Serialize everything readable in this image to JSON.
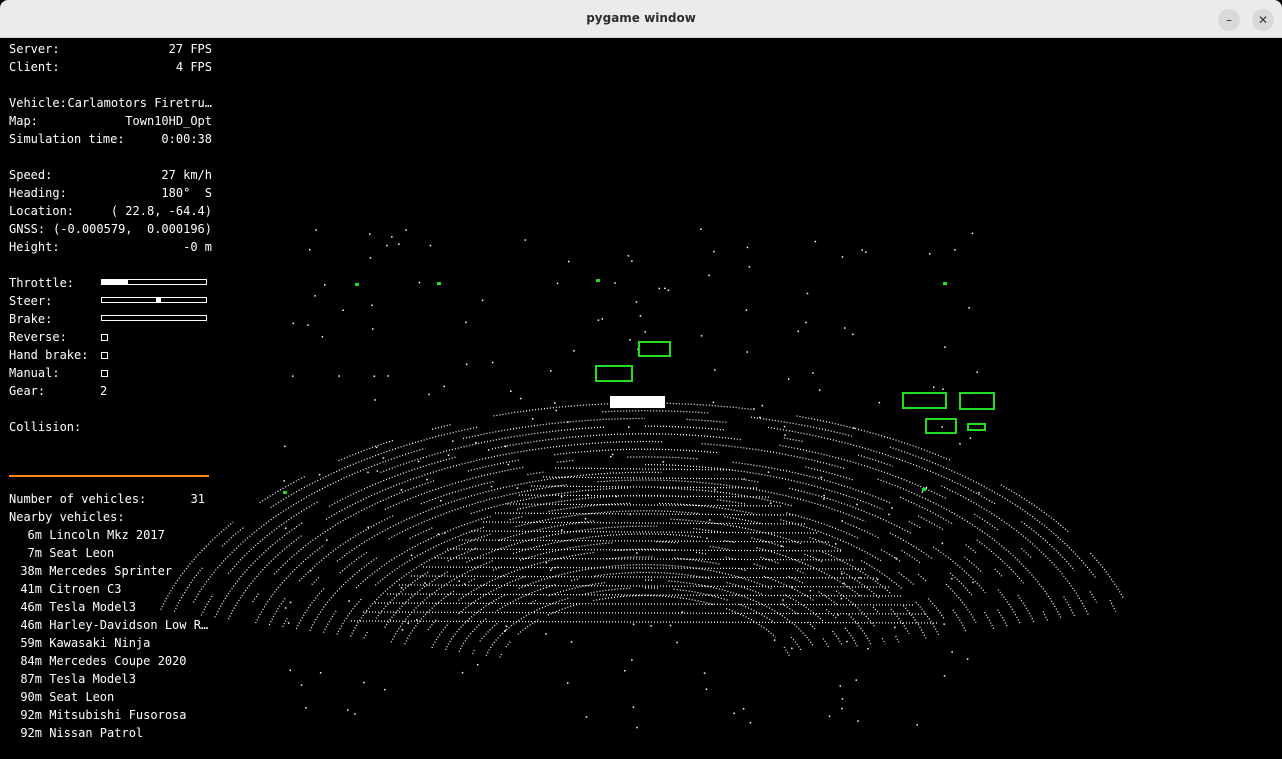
{
  "window": {
    "title": "pygame window",
    "minimize_glyph": "–",
    "close_glyph": "✕"
  },
  "hud": {
    "server_label": "Server:",
    "server_value": "27 FPS",
    "client_label": "Client:",
    "client_value": "4 FPS",
    "vehicle_label": "Vehicle:",
    "vehicle_value": "Carlamotors Firetru…",
    "map_label": "Map:",
    "map_value": "Town10HD_Opt",
    "simtime_label": "Simulation time:",
    "simtime_value": "0:00:38",
    "speed_label": "Speed:",
    "speed_value": "27 km/h",
    "heading_label": "Heading:",
    "heading_value": "180°  S",
    "location_label": "Location:",
    "location_value": "( 22.8, -64.4)",
    "gnss_label": "GNSS:",
    "gnss_value": "(-0.000579,  0.000196)",
    "height_label": "Height:",
    "height_value": "-0 m",
    "throttle_label": "Throttle:",
    "throttle_fraction": 0.25,
    "steer_label": "Steer:",
    "steer_value": 0.08,
    "brake_label": "Brake:",
    "brake_fraction": 0.0,
    "reverse_label": "Reverse:",
    "reverse_checked": false,
    "handbrake_label": "Hand brake:",
    "handbrake_checked": false,
    "manual_label": "Manual:",
    "manual_checked": false,
    "gear_label": "Gear:",
    "gear_value": "2",
    "collision_label": "Collision:",
    "separator_color": "#ff8c1a",
    "num_vehicles_label": "Number of vehicles:",
    "num_vehicles_value": "31",
    "nearby_label": "Nearby vehicles:",
    "nearby": [
      {
        "dist": "6m",
        "name": "Lincoln Mkz 2017"
      },
      {
        "dist": "7m",
        "name": "Seat Leon"
      },
      {
        "dist": "38m",
        "name": "Mercedes Sprinter"
      },
      {
        "dist": "41m",
        "name": "Citroen C3"
      },
      {
        "dist": "46m",
        "name": "Tesla Model3"
      },
      {
        "dist": "46m",
        "name": "Harley-Davidson Low R…"
      },
      {
        "dist": "59m",
        "name": "Kawasaki Ninja"
      },
      {
        "dist": "84m",
        "name": "Mercedes Coupe 2020"
      },
      {
        "dist": "87m",
        "name": "Tesla Model3"
      },
      {
        "dist": "90m",
        "name": "Seat Leon"
      },
      {
        "dist": "92m",
        "name": "Mitsubishi Fusorosa"
      },
      {
        "dist": "92m",
        "name": "Nissan Patrol"
      }
    ]
  },
  "sensor_view": {
    "type": "lidar-point-cloud",
    "point_color": "#ffffff",
    "bbox_color": "#22dd22"
  }
}
